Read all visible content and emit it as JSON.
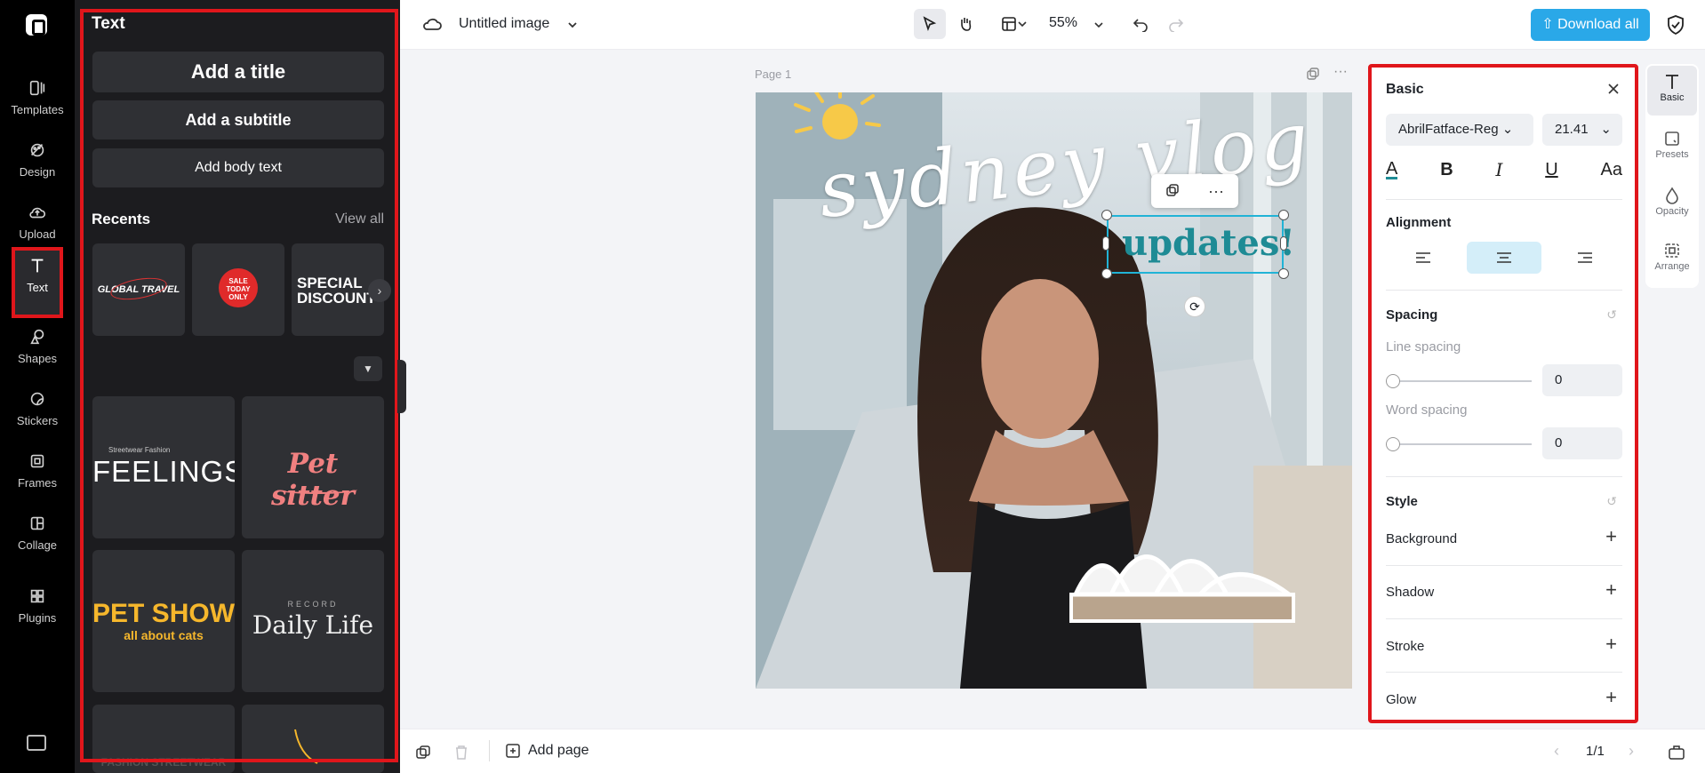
{
  "rail": {
    "items": [
      {
        "label": "Templates",
        "icon": "templates-icon"
      },
      {
        "label": "Design",
        "icon": "design-icon"
      },
      {
        "label": "Upload",
        "icon": "upload-icon"
      },
      {
        "label": "Text",
        "icon": "text-icon"
      },
      {
        "label": "Shapes",
        "icon": "shapes-icon"
      },
      {
        "label": "Stickers",
        "icon": "stickers-icon"
      },
      {
        "label": "Frames",
        "icon": "frames-icon"
      },
      {
        "label": "Collage",
        "icon": "collage-icon"
      },
      {
        "label": "Plugins",
        "icon": "plugins-icon"
      }
    ],
    "active": "Text"
  },
  "panel": {
    "title": "Text",
    "add_title": "Add a title",
    "add_subtitle": "Add a subtitle",
    "add_body": "Add body text",
    "recents_label": "Recents",
    "view_all": "View all",
    "recents": [
      "GLOBAL TRAVEL",
      "SALE TODAY ONLY",
      "SPECIAL DISCOUNT"
    ],
    "templates": [
      {
        "top": "Streetwear Fashion",
        "main": "FEELINGS"
      },
      {
        "main": "Pet sitter"
      },
      {
        "main": "PET SHOW",
        "sub": "all about cats"
      },
      {
        "top": "RECORD",
        "main": "Daily Life"
      },
      {
        "main": "FASHION STREETWEAR"
      }
    ]
  },
  "topbar": {
    "doc_title": "Untitled image",
    "zoom": "55%",
    "download": "Download all"
  },
  "canvas": {
    "page_label": "Page 1",
    "headline": "sydney vlog",
    "selected_text": "updates!"
  },
  "props": {
    "title": "Basic",
    "font": "AbrilFatface-Reg",
    "font_size": "21.41",
    "alignment_label": "Alignment",
    "spacing_label": "Spacing",
    "line_spacing_label": "Line spacing",
    "line_spacing": "0",
    "word_spacing_label": "Word spacing",
    "word_spacing": "0",
    "style_label": "Style",
    "style_items": [
      "Background",
      "Shadow",
      "Stroke",
      "Glow"
    ]
  },
  "side": {
    "items": [
      {
        "label": "Basic",
        "icon": "text-icon"
      },
      {
        "label": "Presets",
        "icon": "presets-icon"
      },
      {
        "label": "Opacity",
        "icon": "opacity-icon"
      },
      {
        "label": "Arrange",
        "icon": "arrange-icon"
      }
    ]
  },
  "bottombar": {
    "add_page": "Add page",
    "page_count": "1/1"
  },
  "colors": {
    "accent": "#2aa8e8",
    "selection": "#21b3d6",
    "highlight": "#e0161b",
    "teal_text": "#1e8b95"
  }
}
